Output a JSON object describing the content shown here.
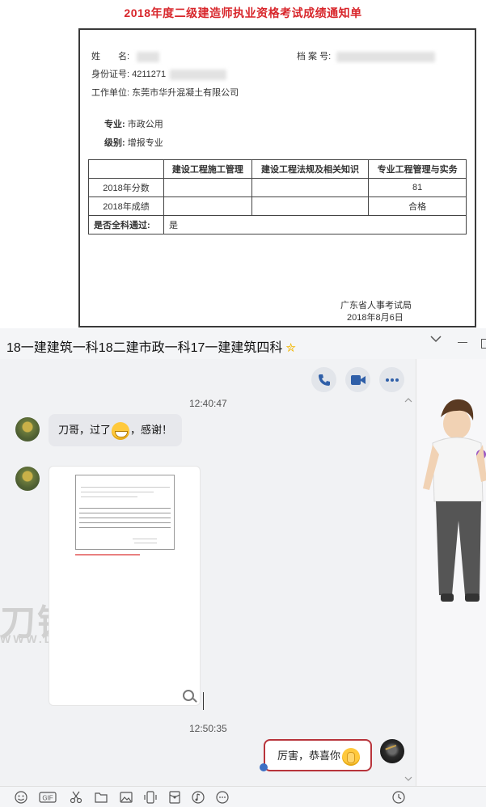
{
  "document": {
    "title": "2018年度二级建造师执业资格考试成绩通知单",
    "name_label": "姓　　名:",
    "archive_label": "档 案 号:",
    "id_label": "身份证号:",
    "id_value": "4211271",
    "employer_label": "工作单位:",
    "employer_value": "东莞市华升混凝土有限公司",
    "major_label": "专业:",
    "major_value": "市政公用",
    "level_label": "级别:",
    "level_value": "增报专业",
    "table": {
      "headers": [
        "",
        "建设工程施工管理",
        "建设工程法规及相关知识",
        "专业工程管理与实务"
      ],
      "rows": [
        [
          "2018年分数",
          "",
          "",
          "81"
        ],
        [
          "2018年成绩",
          "",
          "",
          "合格"
        ]
      ],
      "pass_label": "是否全科通过:",
      "pass_value": "是"
    },
    "issuer": "广东省人事考试局",
    "date": "2018年8月6日"
  },
  "chat": {
    "title": "18一建建筑一科18二建市政一科17一建建筑四科",
    "messages": [
      {
        "time": "12:40:47"
      },
      {
        "text_before": "刀哥，过了",
        "text_after": "，感谢！"
      },
      {
        "time": "12:50:35"
      },
      {
        "text": "厉害，恭喜你"
      }
    ],
    "watermark": "刀锋",
    "watermark_sub": "WWW.DF"
  },
  "colors": {
    "doc_title_red": "#d8262b",
    "bubble_out_border": "#b8343b",
    "chat_bg": "#f1f2f4",
    "star": "#f2b705"
  },
  "icons": [
    "phone-icon",
    "video-icon",
    "more-icon",
    "star-icon",
    "zoom-icon",
    "emoji-icon",
    "gif-icon",
    "scissors-icon",
    "folder-icon",
    "image-icon",
    "screen-icon",
    "redpacket-icon",
    "music-icon",
    "chat-more-icon",
    "history-icon"
  ]
}
